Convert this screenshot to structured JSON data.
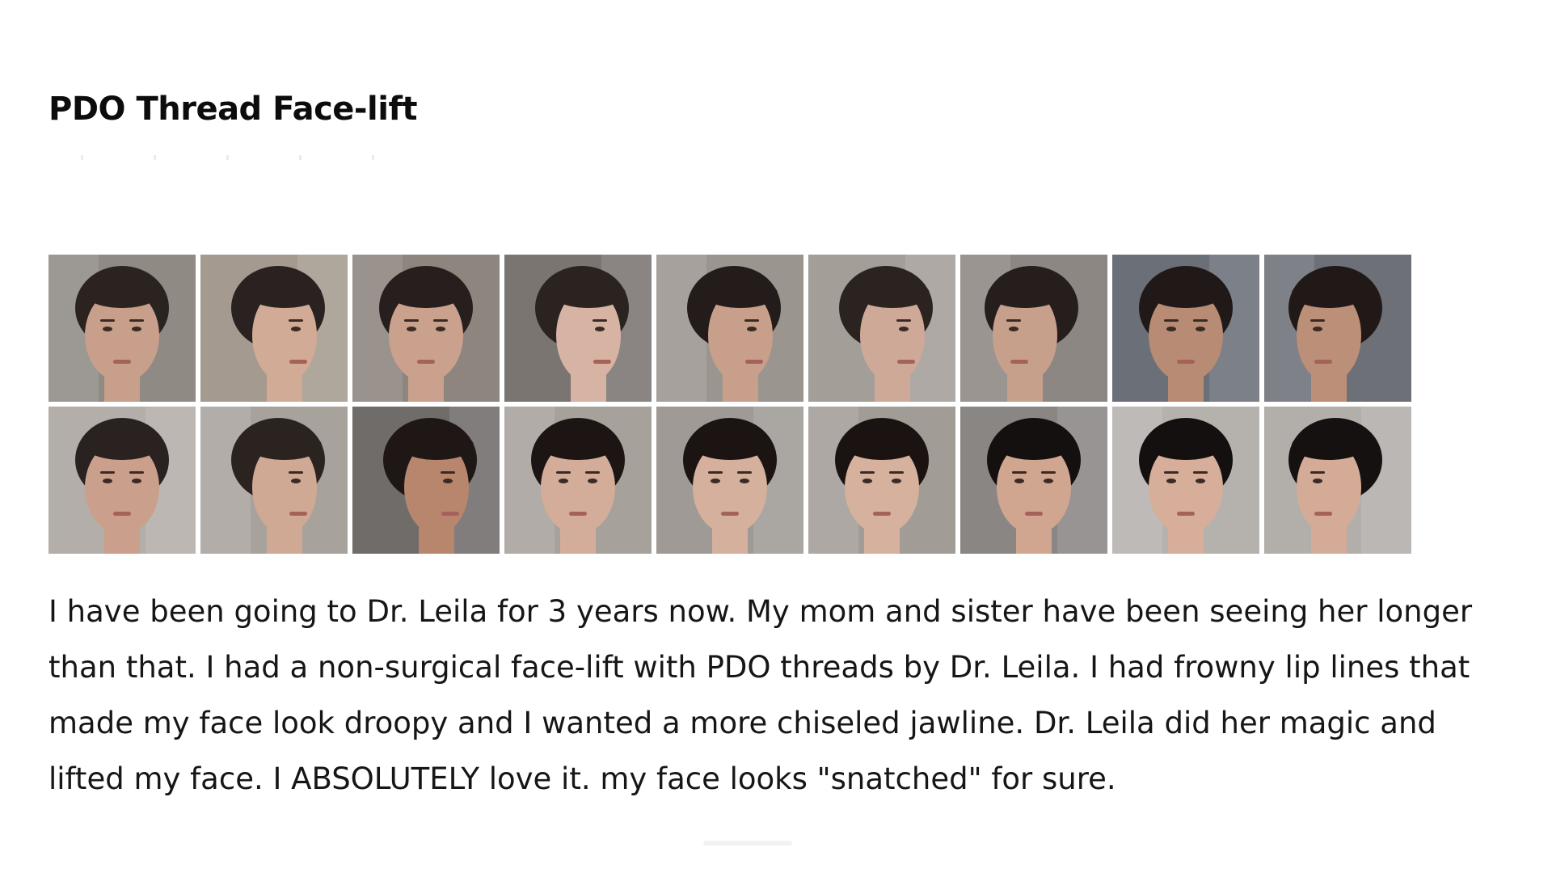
{
  "article": {
    "title": "PDO Thread Face-lift",
    "body_lines": [
      "I have been going to Dr. Leila for 3 years now. My mom and sister have been seeing her longer",
      "than that. I had a non-surgical face-lift with PDO threads by Dr. Leila. I had frowny lip lines that",
      "made my face look droopy and I wanted a more chiseled jawline. Dr. Leila did her magic and",
      "lifted my face. I ABSOLUTELY love it. my face looks \"snatched\" for sure."
    ]
  },
  "gallery": {
    "photos": [
      {
        "bg": "#8f8a84",
        "skin": "#c79f8b",
        "hair": "#2b2320",
        "view": "front"
      },
      {
        "bg": "#a49a8f",
        "skin": "#d1ab96",
        "hair": "#2a2220",
        "view": "right"
      },
      {
        "bg": "#8d857e",
        "skin": "#c9a18d",
        "hair": "#261f1d",
        "view": "front"
      },
      {
        "bg": "#7a7571",
        "skin": "#d6b3a2",
        "hair": "#2b2320",
        "view": "right"
      },
      {
        "bg": "#9a958f",
        "skin": "#c89f8a",
        "hair": "#231c1a",
        "view": "right"
      },
      {
        "bg": "#a39e98",
        "skin": "#cfa997",
        "hair": "#2a2320",
        "view": "right"
      },
      {
        "bg": "#8c8782",
        "skin": "#c7a08c",
        "hair": "#251e1c",
        "view": "left"
      },
      {
        "bg": "#6a6f78",
        "skin": "#b88b74",
        "hair": "#201918",
        "view": "front"
      },
      {
        "bg": "#6d7077",
        "skin": "#bc8f78",
        "hair": "#201918",
        "view": "left"
      },
      {
        "bg": "#b3aea9",
        "skin": "#caa08c",
        "hair": "#2a2220",
        "view": "front"
      },
      {
        "bg": "#a8a29d",
        "skin": "#d0a994",
        "hair": "#2b2320",
        "view": "right"
      },
      {
        "bg": "#6f6c6a",
        "skin": "#b8866d",
        "hair": "#1e1716",
        "view": "right"
      },
      {
        "bg": "#a7a19b",
        "skin": "#d3ad9a",
        "hair": "#1c1514",
        "view": "front"
      },
      {
        "bg": "#9f9a95",
        "skin": "#d5b09d",
        "hair": "#1b1413",
        "view": "front"
      },
      {
        "bg": "#a29c97",
        "skin": "#d6b19e",
        "hair": "#1a1312",
        "view": "front"
      },
      {
        "bg": "#8a8684",
        "skin": "#d1a690",
        "hair": "#151010",
        "view": "front"
      },
      {
        "bg": "#b5b1ad",
        "skin": "#d6ae99",
        "hair": "#141010",
        "view": "front"
      },
      {
        "bg": "#b2aeaa",
        "skin": "#d4ab96",
        "hair": "#151111",
        "view": "left"
      }
    ]
  }
}
